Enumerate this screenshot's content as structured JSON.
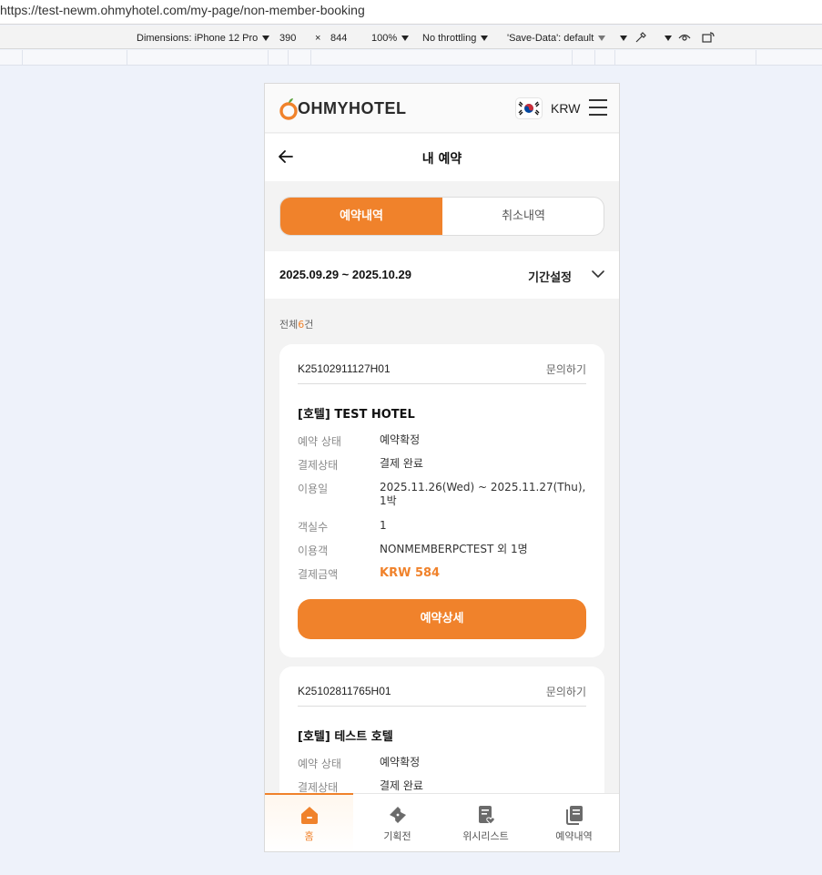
{
  "browser": {
    "url": "https://test-newm.ohmyhotel.com/my-page/non-member-booking"
  },
  "devtools": {
    "dimensions_label": "Dimensions: iPhone 12 Pro",
    "width": "390",
    "times": "×",
    "height": "844",
    "zoom": "100%",
    "throttling": "No throttling",
    "save_data": "'Save-Data': default"
  },
  "header": {
    "logo_text": "OHMYHOTEL",
    "currency": "KRW"
  },
  "page": {
    "title": "내 예약"
  },
  "tabs": [
    {
      "label": "예약내역",
      "active": true
    },
    {
      "label": "취소내역",
      "active": false
    }
  ],
  "period": {
    "range": "2025.09.29 ~ 2025.10.29",
    "set_label": "기간설정"
  },
  "count": {
    "prefix": "전체",
    "number": "6",
    "suffix": "건"
  },
  "bookings": [
    {
      "id": "K25102911127H01",
      "inquiry": "문의하기",
      "hotel": "[호텔] TEST HOTEL",
      "rows": [
        {
          "label": "예약 상태",
          "value": "예약확정"
        },
        {
          "label": "결제상태",
          "value": "결제 완료"
        },
        {
          "label": "이용일",
          "value": "2025.11.26(Wed) ~ 2025.11.27(Thu), 1박"
        },
        {
          "label": "객실수",
          "value": "1"
        },
        {
          "label": "이용객",
          "value": "NONMEMBERPCTEST 외 1명"
        },
        {
          "label": "결제금액",
          "value": "KRW 584"
        }
      ],
      "detail_button": "예약상세"
    },
    {
      "id": "K25102811765H01",
      "inquiry": "문의하기",
      "hotel": "[호텔] 테스트 호텔",
      "rows": [
        {
          "label": "예약 상태",
          "value": "예약확정"
        },
        {
          "label": "결제상태",
          "value": "결제 완료"
        }
      ]
    }
  ],
  "bottom_nav": [
    {
      "label": "홈",
      "icon": "home-icon",
      "active": true
    },
    {
      "label": "기획전",
      "icon": "ticket-icon",
      "active": false
    },
    {
      "label": "위시리스트",
      "icon": "wishlist-icon",
      "active": false
    },
    {
      "label": "예약내역",
      "icon": "bookings-icon",
      "active": false
    }
  ],
  "colors": {
    "accent": "#f0822b",
    "page_bg": "#f3f3f3",
    "outer_bg": "#eef2fa"
  }
}
